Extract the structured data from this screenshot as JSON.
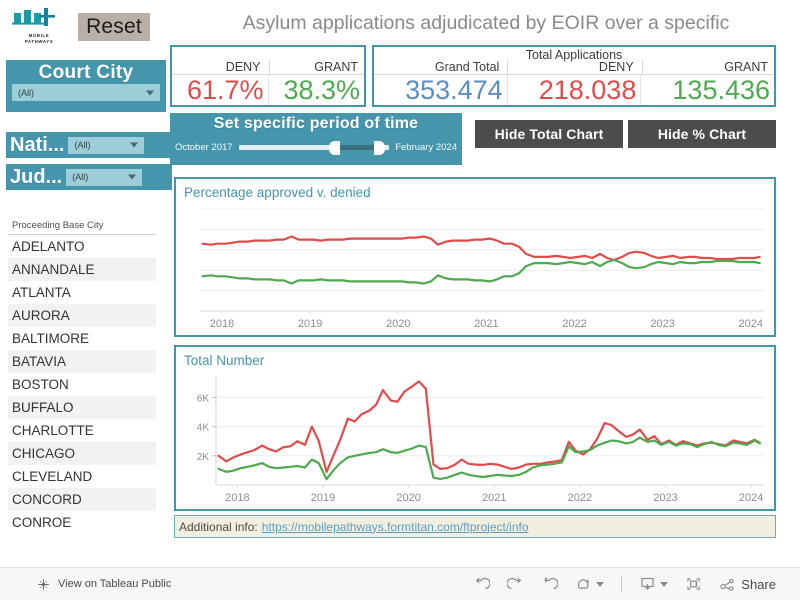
{
  "brand": {
    "logo_line1": "MOBILE",
    "logo_line2": "PATHWAYS",
    "logo_icon": "bridge-buildings-icon"
  },
  "header": {
    "reset_label": "Reset",
    "title": "Asylum applications adjudicated by EOIR over a specific"
  },
  "filters": {
    "court_city": {
      "label": "Court City",
      "value": "(All)"
    },
    "nationality": {
      "label": "Nati...",
      "value": "(All)"
    },
    "judge": {
      "label": "Jud...",
      "value": "(All)"
    }
  },
  "city_list": {
    "header": "Proceeding Base City",
    "items": [
      "ADELANTO",
      "ANNANDALE",
      "ATLANTA",
      "AURORA",
      "BALTIMORE",
      "BATAVIA",
      "BOSTON",
      "BUFFALO",
      "CHARLOTTE",
      "CHICAGO",
      "CLEVELAND",
      "CONCORD",
      "CONROE"
    ]
  },
  "kpi_percent": {
    "deny_label": "DENY",
    "grant_label": "GRANT",
    "deny_value": "61.7%",
    "grant_value": "38.3%"
  },
  "kpi_total": {
    "caption": "Total Applications",
    "grand_total_label": "Grand Total",
    "deny_label": "DENY",
    "grant_label": "GRANT",
    "grand_total_value": "353.474",
    "deny_value": "218.038",
    "grant_value": "135.436"
  },
  "time_filter": {
    "title": "Set specific period of time",
    "start_label": "October 2017",
    "end_label": "February 2024"
  },
  "buttons": {
    "hide_total_chart": "Hide Total Chart",
    "hide_percent_chart": "Hide % Chart"
  },
  "info": {
    "prefix": "Additional info:",
    "link_text": "https://mobilepathways.formtitan.com/ftproject/info"
  },
  "toolbar": {
    "view_on_label": "View on Tableau Public",
    "share_label": "Share",
    "icons": [
      "tableau-logo-icon",
      "undo-icon",
      "redo-icon",
      "revert-icon",
      "refresh-icon",
      "download-icon",
      "fullscreen-icon",
      "share-icon"
    ]
  },
  "colors": {
    "accent": "#4596ac",
    "deny": "#e04b4b",
    "grant": "#4faa4f",
    "grand_total": "#5a8fc2",
    "reset_button": "#b9afa8",
    "hide_button": "#4c4c4c",
    "info_bar": "#f3efe0"
  },
  "chart_data": [
    {
      "type": "line",
      "title": "Percentage approved v. denied",
      "xlabel": "",
      "ylabel": "",
      "xlim": [
        2017.75,
        2024.15
      ],
      "ylim": [
        0,
        100
      ],
      "grid": true,
      "legend": "none",
      "tick_labels_x": [
        "2018",
        "2019",
        "2020",
        "2021",
        "2022",
        "2023",
        "2024"
      ],
      "tick_labels_y": [],
      "x": [
        2017.78,
        2017.87,
        2017.95,
        2018.04,
        2018.12,
        2018.2,
        2018.29,
        2018.37,
        2018.45,
        2018.54,
        2018.62,
        2018.7,
        2018.79,
        2018.87,
        2018.95,
        2019.04,
        2019.12,
        2019.2,
        2019.29,
        2019.37,
        2019.45,
        2019.54,
        2019.62,
        2019.7,
        2019.79,
        2019.87,
        2019.95,
        2020.04,
        2020.12,
        2020.2,
        2020.29,
        2020.37,
        2020.45,
        2020.54,
        2020.62,
        2020.7,
        2020.79,
        2020.87,
        2020.95,
        2021.04,
        2021.12,
        2021.2,
        2021.29,
        2021.37,
        2021.45,
        2021.54,
        2021.62,
        2021.7,
        2021.79,
        2021.87,
        2021.95,
        2022.04,
        2022.12,
        2022.2,
        2022.29,
        2022.37,
        2022.45,
        2022.54,
        2022.62,
        2022.7,
        2022.79,
        2022.87,
        2022.95,
        2023.04,
        2023.12,
        2023.2,
        2023.29,
        2023.37,
        2023.45,
        2023.54,
        2023.62,
        2023.7,
        2023.79,
        2023.87,
        2023.95,
        2024.04,
        2024.1
      ],
      "series": [
        {
          "name": "DENY",
          "color": "#e04b4b",
          "values": [
            66,
            65,
            66,
            66,
            67,
            68,
            68,
            69,
            69,
            69,
            70,
            70,
            73,
            70,
            70,
            70,
            69,
            70,
            70,
            70,
            71,
            71,
            71,
            71,
            71,
            71,
            71,
            71,
            72,
            72,
            73,
            71,
            65,
            68,
            69,
            69,
            69,
            70,
            70,
            71,
            69,
            66,
            66,
            63,
            56,
            53,
            53,
            53,
            54,
            53,
            52,
            53,
            54,
            52,
            56,
            52,
            50,
            53,
            57,
            58,
            57,
            54,
            52,
            53,
            54,
            52,
            53,
            53,
            52,
            52,
            51,
            51,
            51,
            52,
            52,
            52,
            53
          ]
        },
        {
          "name": "GRANT",
          "color": "#4faa4f",
          "values": [
            34,
            35,
            34,
            34,
            33,
            32,
            32,
            31,
            31,
            31,
            30,
            30,
            27,
            30,
            30,
            30,
            31,
            30,
            30,
            30,
            29,
            29,
            29,
            29,
            29,
            29,
            29,
            29,
            28,
            28,
            27,
            29,
            35,
            32,
            31,
            31,
            31,
            30,
            30,
            29,
            31,
            34,
            34,
            37,
            44,
            47,
            47,
            47,
            46,
            47,
            48,
            47,
            46,
            48,
            44,
            48,
            50,
            47,
            43,
            42,
            43,
            46,
            48,
            47,
            46,
            48,
            47,
            47,
            48,
            48,
            49,
            49,
            49,
            48,
            48,
            48,
            47
          ]
        }
      ]
    },
    {
      "type": "line",
      "title": "Total Number",
      "xlabel": "",
      "ylabel": "",
      "xlim": [
        2017.75,
        2024.15
      ],
      "ylim": [
        0,
        7400
      ],
      "grid": true,
      "legend": "none",
      "tick_labels_x": [
        "2018",
        "2019",
        "2020",
        "2021",
        "2022",
        "2023",
        "2024"
      ],
      "tick_labels_y": [
        "2K",
        "4K",
        "6K"
      ],
      "ticks_y": [
        2000,
        4000,
        6000
      ],
      "x": [
        2017.78,
        2017.87,
        2017.95,
        2018.04,
        2018.12,
        2018.2,
        2018.29,
        2018.37,
        2018.45,
        2018.54,
        2018.62,
        2018.7,
        2018.79,
        2018.87,
        2018.95,
        2019.04,
        2019.12,
        2019.2,
        2019.29,
        2019.37,
        2019.45,
        2019.54,
        2019.62,
        2019.7,
        2019.79,
        2019.87,
        2019.95,
        2020.04,
        2020.12,
        2020.2,
        2020.29,
        2020.37,
        2020.45,
        2020.54,
        2020.62,
        2020.7,
        2020.79,
        2020.87,
        2020.95,
        2021.04,
        2021.12,
        2021.2,
        2021.29,
        2021.37,
        2021.45,
        2021.54,
        2021.62,
        2021.7,
        2021.79,
        2021.87,
        2021.95,
        2022.04,
        2022.12,
        2022.2,
        2022.29,
        2022.37,
        2022.45,
        2022.54,
        2022.62,
        2022.7,
        2022.79,
        2022.87,
        2022.95,
        2023.04,
        2023.12,
        2023.2,
        2023.29,
        2023.37,
        2023.45,
        2023.54,
        2023.62,
        2023.7,
        2023.79,
        2023.87,
        2023.95,
        2024.04,
        2024.1
      ],
      "series": [
        {
          "name": "DENY",
          "color": "#e04b4b",
          "values": [
            2000,
            1620,
            1880,
            2100,
            2250,
            2400,
            2700,
            2450,
            2300,
            2600,
            2650,
            3000,
            2750,
            4000,
            3000,
            900,
            2000,
            3100,
            4550,
            4350,
            4850,
            5100,
            5500,
            6500,
            5800,
            5700,
            6400,
            6750,
            7100,
            6600,
            1400,
            1100,
            1150,
            1400,
            1750,
            1450,
            1400,
            1380,
            1450,
            1400,
            1250,
            1100,
            1200,
            1400,
            1450,
            1450,
            1550,
            1600,
            1700,
            2950,
            2350,
            2100,
            2450,
            3150,
            4250,
            4100,
            3700,
            3300,
            3450,
            3800,
            3100,
            3350,
            2800,
            3050,
            2750,
            3000,
            2850,
            2700,
            2850,
            2900,
            2800,
            2700,
            3050,
            2950,
            2850,
            3100,
            2900
          ]
        },
        {
          "name": "GRANT",
          "color": "#4faa4f",
          "values": [
            1100,
            900,
            980,
            1150,
            1250,
            1350,
            1500,
            1250,
            1150,
            1200,
            1250,
            1300,
            1200,
            1750,
            1500,
            400,
            1000,
            1500,
            1900,
            2000,
            2100,
            2200,
            2250,
            2450,
            2250,
            2200,
            2350,
            2500,
            2700,
            2600,
            500,
            420,
            500,
            700,
            850,
            700,
            600,
            550,
            620,
            700,
            650,
            620,
            700,
            900,
            1200,
            1350,
            1400,
            1450,
            1550,
            2650,
            2250,
            2300,
            2400,
            2700,
            2900,
            3050,
            3000,
            2850,
            2950,
            3250,
            2950,
            3050,
            2750,
            2950,
            2700,
            2850,
            2800,
            2600,
            2800,
            2950,
            2750,
            2650,
            2900,
            2850,
            2750,
            3050,
            2850
          ]
        }
      ]
    }
  ]
}
